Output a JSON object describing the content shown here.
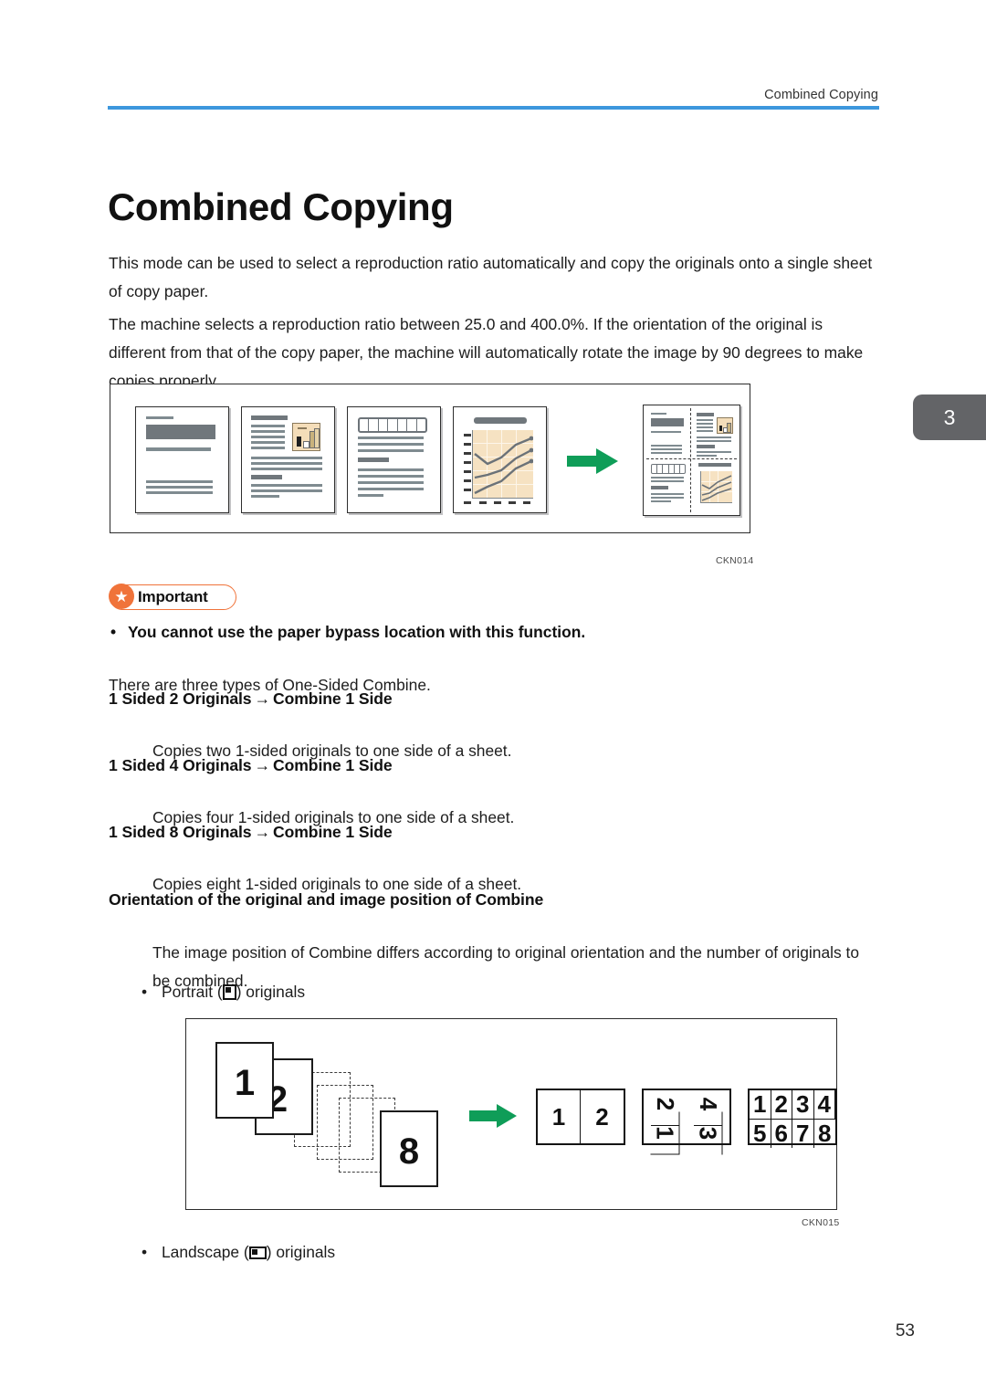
{
  "header": {
    "running_head": "Combined Copying",
    "rule_color": "#3d97dd"
  },
  "side_tab": {
    "chapter": "3",
    "color": "#636467"
  },
  "page_title": "Combined Copying",
  "paragraphs": {
    "intro": "This mode can be used to select a reproduction ratio automatically and copy the originals onto a single sheet of copy paper.",
    "ratio": "The machine selects a reproduction ratio between 25.0 and 400.0%. If the orientation of the original is different from that of the copy paper, the machine will automatically rotate the image by 90 degrees to make copies properly."
  },
  "figure1": {
    "caption": "CKN014"
  },
  "important": {
    "label": "Important",
    "icon": "star-icon",
    "color": "#f0733a",
    "items": [
      "You cannot use the paper bypass location with this function."
    ]
  },
  "types_intro": "There are three types of One-Sided Combine.",
  "combine_types": [
    {
      "heading_left": "1 Sided 2 Originals",
      "arrow": "→",
      "heading_right": "Combine 1 Side",
      "description": "Copies two 1-sided originals to one side of a sheet."
    },
    {
      "heading_left": "1 Sided 4 Originals",
      "arrow": "→",
      "heading_right": "Combine 1 Side",
      "description": "Copies four 1-sided originals to one side of a sheet."
    },
    {
      "heading_left": "1 Sided 8 Originals",
      "arrow": "→",
      "heading_right": "Combine 1 Side",
      "description": "Copies eight 1-sided originals to one side of a sheet."
    }
  ],
  "orientation_section": {
    "heading": "Orientation of the original and image position of Combine",
    "body": "The image position of Combine differs according to original orientation and the number of originals to be combined.",
    "bullet_portrait_before": "Portrait (",
    "bullet_portrait_after": ") originals",
    "bullet_landscape_before": "Landscape (",
    "bullet_landscape_after": ") originals"
  },
  "figure2": {
    "caption": "CKN015",
    "originals": [
      "1",
      "2",
      "8"
    ],
    "outputs": [
      {
        "name": "2-up",
        "rows": [
          [
            "1",
            "2"
          ]
        ],
        "rotated": false
      },
      {
        "name": "4-up",
        "rows": [
          [
            "1",
            "2"
          ],
          [
            "3",
            "4"
          ]
        ],
        "rotated": true
      },
      {
        "name": "8-up",
        "rows": [
          [
            "1",
            "2",
            "3",
            "4"
          ],
          [
            "5",
            "6",
            "7",
            "8"
          ]
        ],
        "rotated": false
      }
    ]
  },
  "folio": "53"
}
